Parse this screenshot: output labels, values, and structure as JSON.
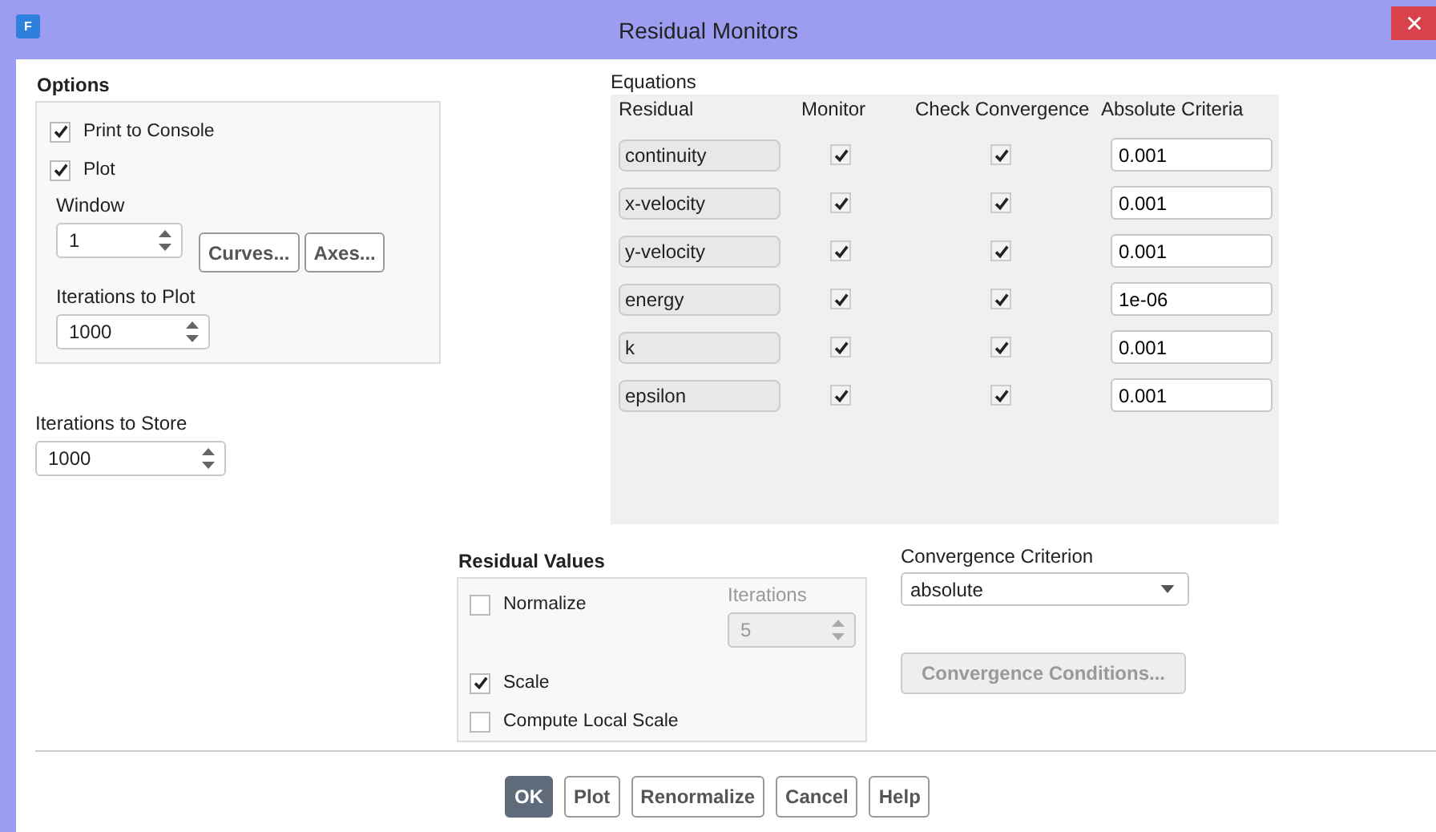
{
  "window": {
    "title": "Residual Monitors",
    "icon_text": "F"
  },
  "options": {
    "title": "Options",
    "checkboxes": [
      {
        "label": "Print to Console",
        "checked": true
      },
      {
        "label": "Plot",
        "checked": true
      }
    ],
    "window_field": {
      "label": "Window",
      "value": "1"
    },
    "buttons": [
      "Curves...",
      "Axes..."
    ],
    "iterations_to_plot": {
      "label": "Iterations to Plot",
      "value": "1000"
    }
  },
  "iterations_to_store": {
    "label": "Iterations to Store",
    "value": "1000"
  },
  "equations": {
    "title": "Equations",
    "columns": [
      "Residual",
      "Monitor",
      "Check Convergence",
      "Absolute Criteria"
    ],
    "rows": [
      {
        "residual": "continuity",
        "monitor": true,
        "check": true,
        "criteria": "0.001"
      },
      {
        "residual": "x-velocity",
        "monitor": true,
        "check": true,
        "criteria": "0.001"
      },
      {
        "residual": "y-velocity",
        "monitor": true,
        "check": true,
        "criteria": "0.001"
      },
      {
        "residual": "energy",
        "monitor": true,
        "check": true,
        "criteria": "1e-06"
      },
      {
        "residual": "k",
        "monitor": true,
        "check": true,
        "criteria": "0.001"
      },
      {
        "residual": "epsilon",
        "monitor": true,
        "check": true,
        "criteria": "0.001"
      }
    ]
  },
  "residual_values": {
    "title": "Residual Values",
    "normalize": {
      "label": "Normalize",
      "checked": false
    },
    "iterations": {
      "label": "Iterations",
      "value": "5",
      "disabled": true
    },
    "scale": {
      "label": "Scale",
      "checked": true
    },
    "compute_local_scale": {
      "label": "Compute Local Scale",
      "checked": false
    }
  },
  "convergence": {
    "label": "Convergence Criterion",
    "value": "absolute",
    "button": {
      "label": "Convergence Conditions...",
      "disabled": true
    }
  },
  "buttons": [
    {
      "label": "OK",
      "selected": true
    },
    {
      "label": "Plot",
      "selected": false
    },
    {
      "label": "Renormalize",
      "selected": false
    },
    {
      "label": "Cancel",
      "selected": false
    },
    {
      "label": "Help",
      "selected": false
    }
  ]
}
